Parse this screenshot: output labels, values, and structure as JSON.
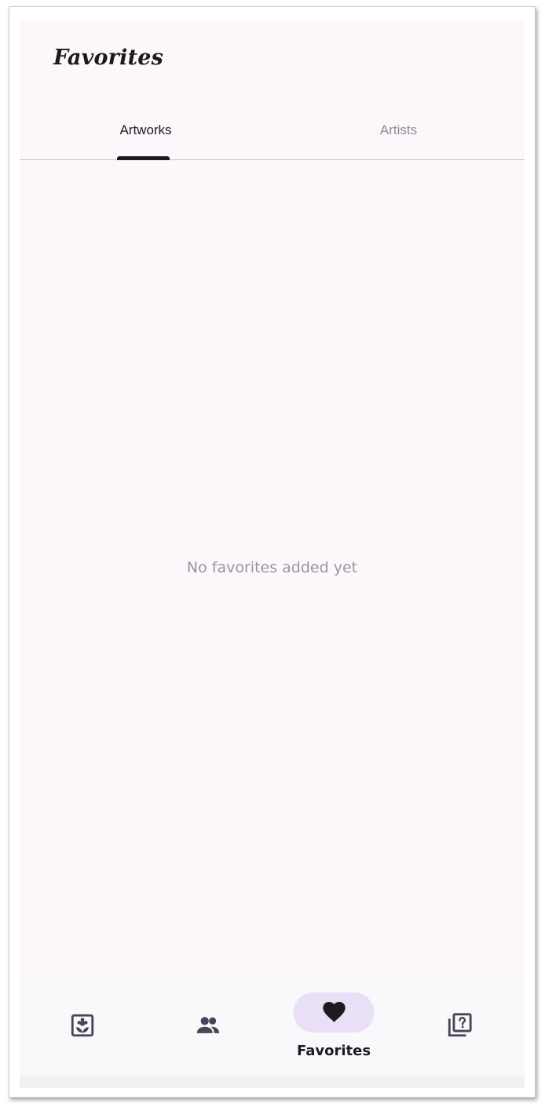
{
  "app": {
    "title": "Favorites"
  },
  "tabs": [
    {
      "label": "Artworks",
      "selected": true
    },
    {
      "label": "Artists",
      "selected": false
    }
  ],
  "content": {
    "empty_message": "No favorites added yet"
  },
  "bottom_nav": {
    "items": [
      {
        "icon": "artwork-icon",
        "label": "",
        "selected": false
      },
      {
        "icon": "people-icon",
        "label": "",
        "selected": false
      },
      {
        "icon": "heart-icon",
        "label": "Favorites",
        "selected": true
      },
      {
        "icon": "quiz-icon",
        "label": "",
        "selected": false
      }
    ]
  },
  "colors": {
    "background": "#fdf7fc",
    "selected_pill": "#e9dff7",
    "text_primary": "#1d1b20",
    "text_muted": "#9a969c"
  }
}
